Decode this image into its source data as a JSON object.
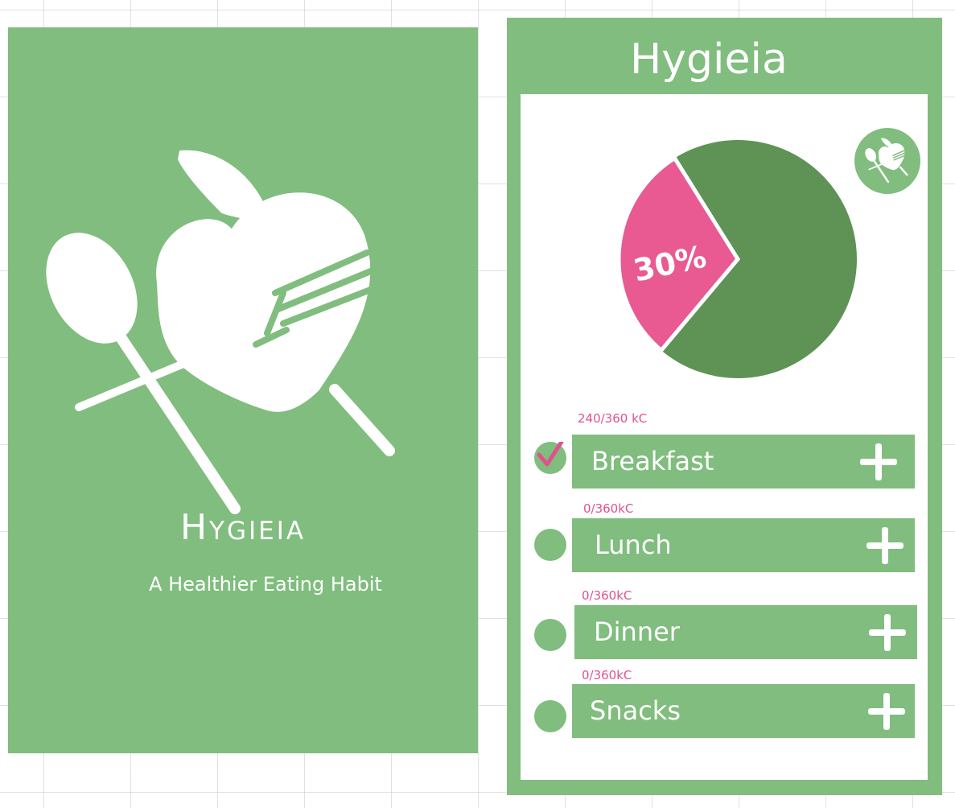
{
  "splash": {
    "title": "Hygieia",
    "tagline": "A Healthier Eating Habit"
  },
  "app": {
    "title": "Hygieia",
    "progress": {
      "percent_label": "30%",
      "consumed_fraction": 0.3,
      "colors": {
        "consumed": "#e85a91",
        "remaining": "#5e9355"
      }
    },
    "meals": [
      {
        "name": "Breakfast",
        "kcal": "240/360 kC",
        "checked": true
      },
      {
        "name": "Lunch",
        "kcal": "0/360kC",
        "checked": false
      },
      {
        "name": "Dinner",
        "kcal": "0/360kC",
        "checked": false
      },
      {
        "name": "Snacks",
        "kcal": "0/360kC",
        "checked": false
      }
    ]
  },
  "colors": {
    "brand_green": "#80bd7e",
    "dark_green": "#5e9355",
    "accent_pink": "#e0528f"
  },
  "icons": {
    "logo": "spoon-fork-heart-icon",
    "add": "plus-icon",
    "check": "checkmark-icon"
  }
}
